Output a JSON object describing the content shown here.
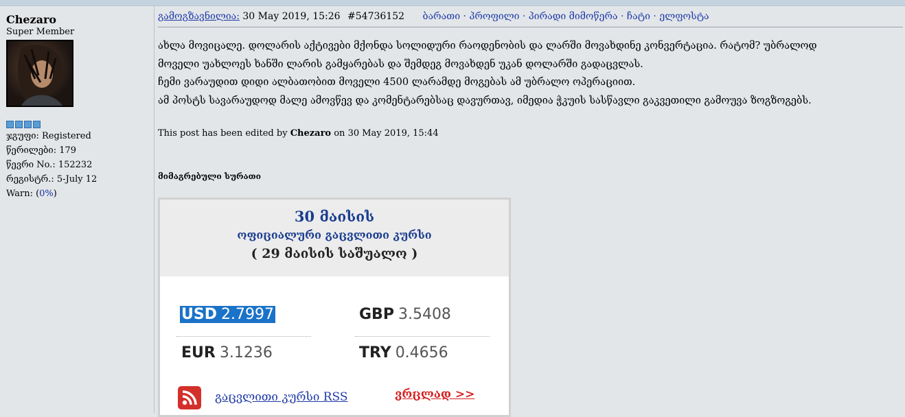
{
  "author": {
    "name": "Chezaro",
    "rank": "Super Member",
    "avatar_icon": "user-avatar-icon",
    "group": "ჯგუფი: Registered",
    "posts": "წერილები: 179",
    "member_no": "წევრი No.: 152232",
    "registered": "რეგისტრ.: 5-July 12",
    "warn_label": "Warn: (",
    "warn_value": "0%",
    "warn_close": ")"
  },
  "post": {
    "sent_label": "გამოგზავნილია:",
    "date": "30 May 2019, 15:26",
    "post_id": "#54736152",
    "links": "ბარათი · პროფილი · პირადი მიმოწერა · ჩატი · ელფოსტა",
    "body_lines": [
      "ახლა მოვიცალე. დოლარის აქტივები მქონდა სოლიდური რაოდენობის და ლარში მოვახდინე კონვერტაცია. რატომ? უბრალოდ",
      "მოველი უახლოეს ხანში ლარის გამყარებას და შემდეგ მოვახდენ უკან დოლარში გადაცვლას.",
      "ჩემი ვარაუდით დიდი ალბათობით მოველი 4500 ლარამდე მოგებას ამ უბრალო ოპერაციით.",
      "ამ პოსტს სავარაუდოდ მალე ამოვწევ და კომენტარებსაც დავურთავ, იმედია ჭკუის სასწავლი გაკვეთილი გამოუვა ზოგზოგებს."
    ],
    "edited_prefix": "This post has been edited by",
    "edited_by": "Chezaro",
    "edited_suffix": "on 30 May 2019, 15:44",
    "attached_label": "მიმაგრებული სურათი"
  },
  "rates": {
    "date": "30 მაისის",
    "subtitle": "ოფიციალური გაცვლითი კურსი",
    "average": "( 29 მაისის საშუალო )",
    "items": [
      {
        "code": "USD",
        "value": "2.7997"
      },
      {
        "code": "GBP",
        "value": "3.5408"
      },
      {
        "code": "EUR",
        "value": "3.1236"
      },
      {
        "code": "TRY",
        "value": "0.4656"
      }
    ],
    "rss_icon": "rss-icon",
    "rss_link": "გაცვლითი კურსი RSS",
    "detail_link": "ვრცლად >>",
    "colors": {
      "title": "#1a3d8f",
      "highlight": "#1a73c8",
      "detail": "#d51f1f",
      "rss": "#d3302b"
    }
  }
}
